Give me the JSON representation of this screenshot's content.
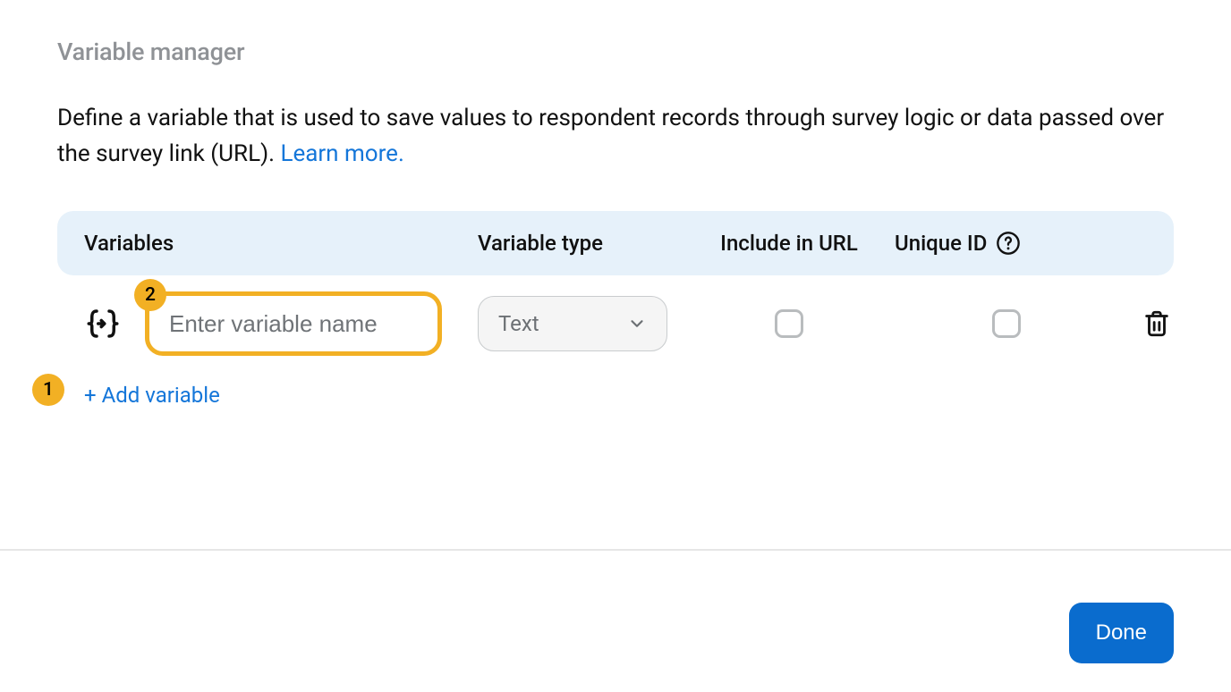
{
  "title": "Variable manager",
  "description_prefix": "Define a variable that is used to save values to respondent records through survey logic or data passed over the survey link (URL). ",
  "learn_more": "Learn more.",
  "columns": {
    "variables": "Variables",
    "variable_type": "Variable type",
    "include_url": "Include in URL",
    "unique_id": "Unique ID"
  },
  "row": {
    "name_placeholder": "Enter variable name",
    "name_value": "",
    "type_value": "Text",
    "include_in_url": false,
    "unique_id": false
  },
  "add_variable": "+ Add variable",
  "done": "Done",
  "annotations": {
    "badge1": "1",
    "badge2": "2"
  }
}
